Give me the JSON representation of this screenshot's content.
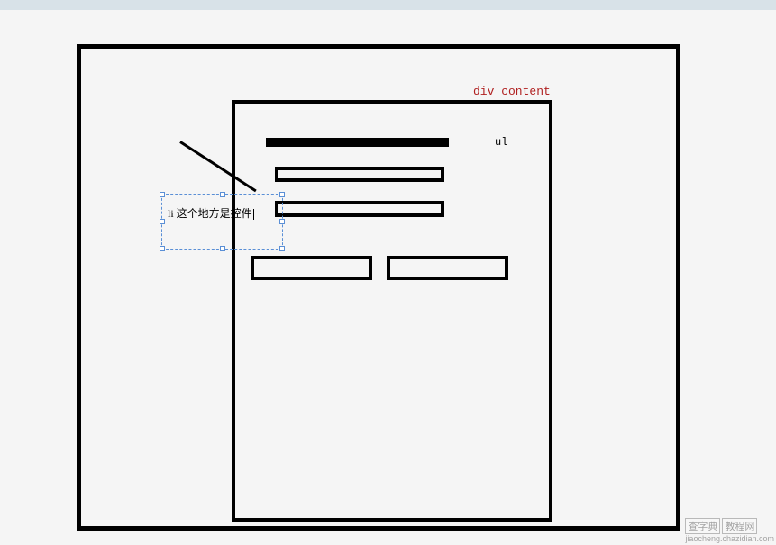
{
  "labels": {
    "content": "div content",
    "ul": "ul",
    "li_text": "li 这个地方是控件"
  },
  "watermark": {
    "line1_a": "查字典",
    "line1_b": "教程网",
    "line2": "jiaocheng.chazidian.com"
  }
}
